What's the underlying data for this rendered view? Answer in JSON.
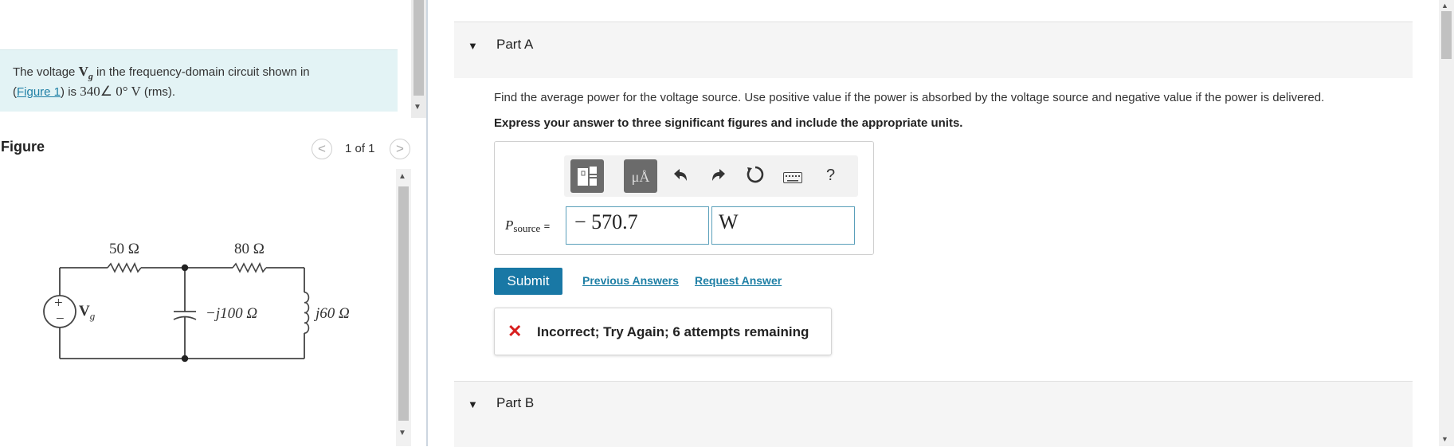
{
  "problem": {
    "text_before": "The voltage",
    "var_symbol": "V",
    "var_subscript": "g",
    "text_middle": "in the frequency-domain circuit shown in",
    "figure_link": "Figure 1",
    "text_after": "is",
    "value_expr": "340∠ 0° V",
    "value_suffix": "(rms)."
  },
  "figure": {
    "title": "Figure",
    "counter": "1 of 1",
    "prev_glyph": "<",
    "next_glyph": ">",
    "circuit_labels": {
      "r1": "50 Ω",
      "r2": "80 Ω",
      "cap": "−j100 Ω",
      "ind": "j60 Ω",
      "src_symbol": "V",
      "src_sub": "g",
      "plus": "+",
      "minus": "−"
    }
  },
  "partA": {
    "label": "Part A",
    "instructions": "Find the average power for the voltage source. Use positive value if the power is absorbed by the voltage source and negative value if the power is delivered.",
    "instructions_bold": "Express your answer to three significant figures and include the appropriate units.",
    "toolbar": {
      "units_label": "μÅ",
      "help_label": "?"
    },
    "var_label": "P",
    "var_sub": "source",
    "var_eq": "=",
    "value": "− 570.7",
    "units": "W",
    "submit_label": "Submit",
    "previous_answers": "Previous Answers",
    "request_answer": "Request Answer",
    "feedback": "Incorrect; Try Again; 6 attempts remaining"
  },
  "partB": {
    "label": "Part B"
  },
  "colors": {
    "accent": "#1978a5",
    "link": "#1e7fa5",
    "problem_bg": "#e3f3f5",
    "error": "#d81e1e"
  }
}
